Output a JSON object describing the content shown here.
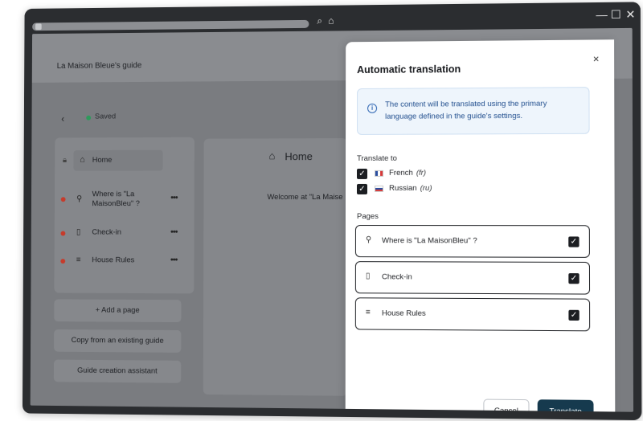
{
  "window": {
    "controls": {
      "minimize": "—",
      "maximize": "☐",
      "close": "✕"
    }
  },
  "header": {
    "guide_title": "La Maison Bleue's guide"
  },
  "editor": {
    "back_icon": "‹",
    "saved_label": "Saved"
  },
  "sidebar": {
    "home_label": "Home",
    "items": [
      {
        "label": "Where is \"La MaisonBleu\" ?",
        "icon": "location-pin-icon"
      },
      {
        "label": "Check-in",
        "icon": "door-icon"
      },
      {
        "label": "House Rules",
        "icon": "rules-icon"
      }
    ],
    "more_label": "•••",
    "add_page": "+ Add a page",
    "copy_guide": "Copy from an existing guide",
    "assistant": "Guide creation assistant"
  },
  "main": {
    "title": "Home",
    "welcome_text": "Welcome at \"La Maise"
  },
  "modal": {
    "title": "Automatic translation",
    "close_label": "×",
    "info_text": "The content will be translated using the primary language defined in the guide's settings.",
    "translate_to_label": "Translate to",
    "languages": [
      {
        "name": "French",
        "code": "(fr)",
        "checked": true
      },
      {
        "name": "Russian",
        "code": "(ru)",
        "checked": true
      }
    ],
    "pages_label": "Pages",
    "pages": [
      {
        "label": "Where is \"La MaisonBleu\" ?",
        "icon": "location-pin-icon",
        "checked": true
      },
      {
        "label": "Check-in",
        "icon": "door-icon",
        "checked": true
      },
      {
        "label": "House Rules",
        "icon": "rules-icon",
        "checked": true
      }
    ],
    "cancel_label": "Cancel",
    "translate_label": "Translate",
    "colors": {
      "primary": "#163a4e",
      "info_bg": "#eef5fc",
      "info_text": "#23508f"
    }
  }
}
